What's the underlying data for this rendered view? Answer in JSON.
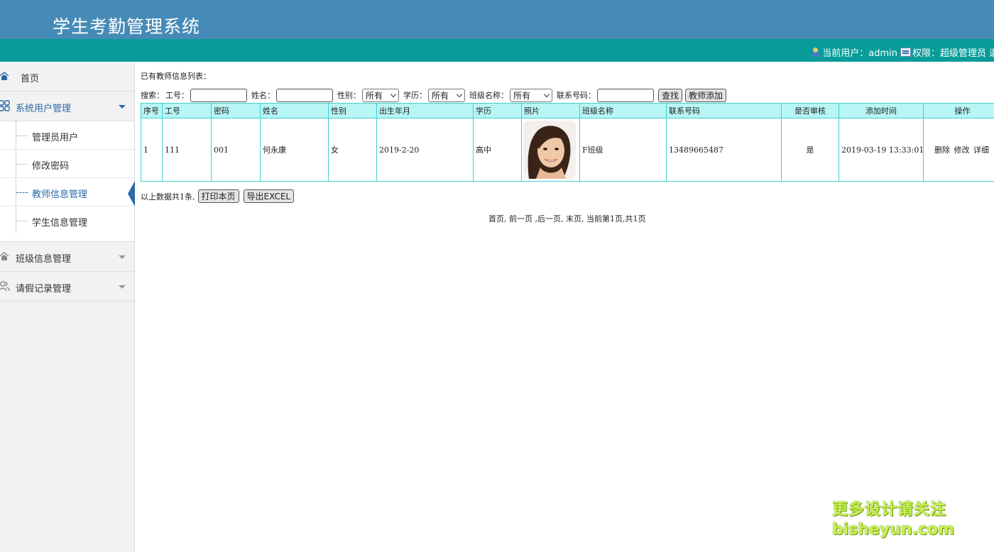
{
  "app": {
    "title": "学生考勤管理系统"
  },
  "userbar": {
    "current_user_label": "当前用户：admin",
    "permission_label": "权限：超级管理员",
    "logout_label": "退"
  },
  "sidebar": {
    "home": "首页",
    "groups": [
      {
        "label": "系统用户管理",
        "open": true,
        "items": [
          "管理员用户",
          "修改密码",
          "教师信息管理",
          "学生信息管理"
        ],
        "active_index": 2
      },
      {
        "label": "班级信息管理",
        "open": false
      },
      {
        "label": "请假记录管理",
        "open": false
      }
    ]
  },
  "main": {
    "list_title": "已有教师信息列表：",
    "search": {
      "prefix": "搜索：",
      "job_no_label": "工号：",
      "name_label": "姓名：",
      "gender_label": "性别：",
      "gender_value": "所有",
      "education_label": "学历：",
      "education_value": "所有",
      "class_label": "班级名称：",
      "class_value": "所有",
      "phone_label": "联系号码：",
      "search_button": "查找",
      "add_button": "教师添加"
    },
    "table": {
      "headers": [
        "序号",
        "工号",
        "密码",
        "姓名",
        "性别",
        "出生年月",
        "学历",
        "照片",
        "班级名称",
        "联系号码",
        "是否审核",
        "添加时间",
        "操作"
      ],
      "rows": [
        {
          "seq": "1",
          "job_no": "111",
          "password": "001",
          "name": "何永康",
          "gender": "女",
          "birth": "2019-2-20",
          "education": "高中",
          "class": "F班级",
          "phone": "13489665487",
          "audited": "是",
          "added": "2019-03-19 13:33:01",
          "actions": [
            "删除",
            "修改",
            "详细"
          ]
        }
      ]
    },
    "summary": "以上数据共1条,",
    "print_button": "打印本页",
    "export_button": "导出EXCEL",
    "pager": "首页, 前一页 ,后一页, 末页, 当前第1页,共1页"
  },
  "watermark": {
    "line1": "更多设计请关注",
    "line2": "bisheyun.com"
  }
}
